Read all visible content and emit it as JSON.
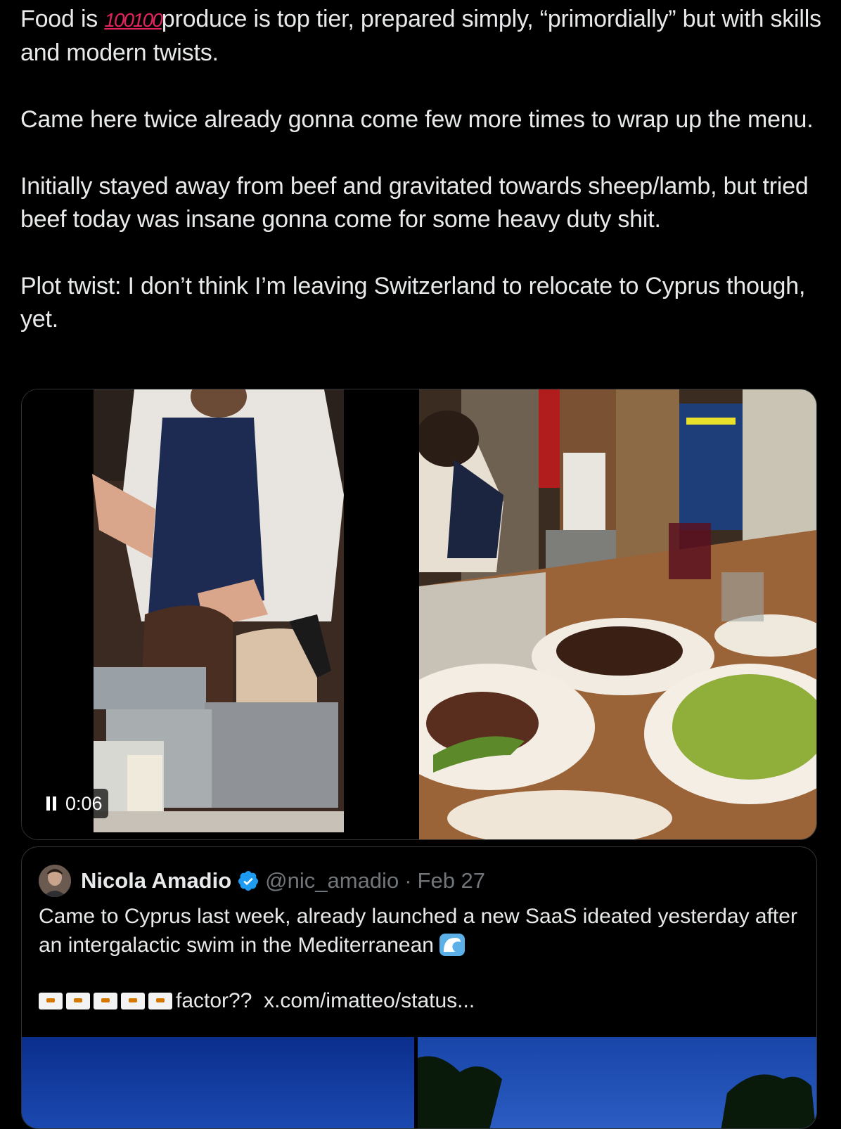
{
  "tweet": {
    "p1_pre": "Food is ",
    "p1_emoji": "100100",
    "p1_post": "produce is top tier, prepared simply, “primordially” but with skills and modern twists.",
    "p2": "Came here twice already gonna come few more times to wrap up the menu.",
    "p3": "Initially stayed away from beef and gravitated towards sheep/lamb, but tried beef today was insane gonna come for some heavy duty shit.",
    "p4": "Plot twist: I don’t think I’m leaving Switzerland to relocate to Cyprus though, yet."
  },
  "media": {
    "video_time": "0:06",
    "video_state_icon": "pause-icon"
  },
  "quote": {
    "name": "Nicola Amadio",
    "handle": "@nic_amadio",
    "separator": "·",
    "date": "Feb 27",
    "text": "Came to Cyprus last week, already launched a new SaaS ideated yesterday after an intergalactic swim in the Mediterranean",
    "flag_count": 5,
    "factor_text": "factor??",
    "link": "x.com/imatteo/status..."
  },
  "colors": {
    "background": "#000000",
    "text": "#e7e9ea",
    "muted": "#71767b",
    "border": "#2f3336",
    "verified": "#1d9bf0",
    "hundred": "#e0245e"
  }
}
